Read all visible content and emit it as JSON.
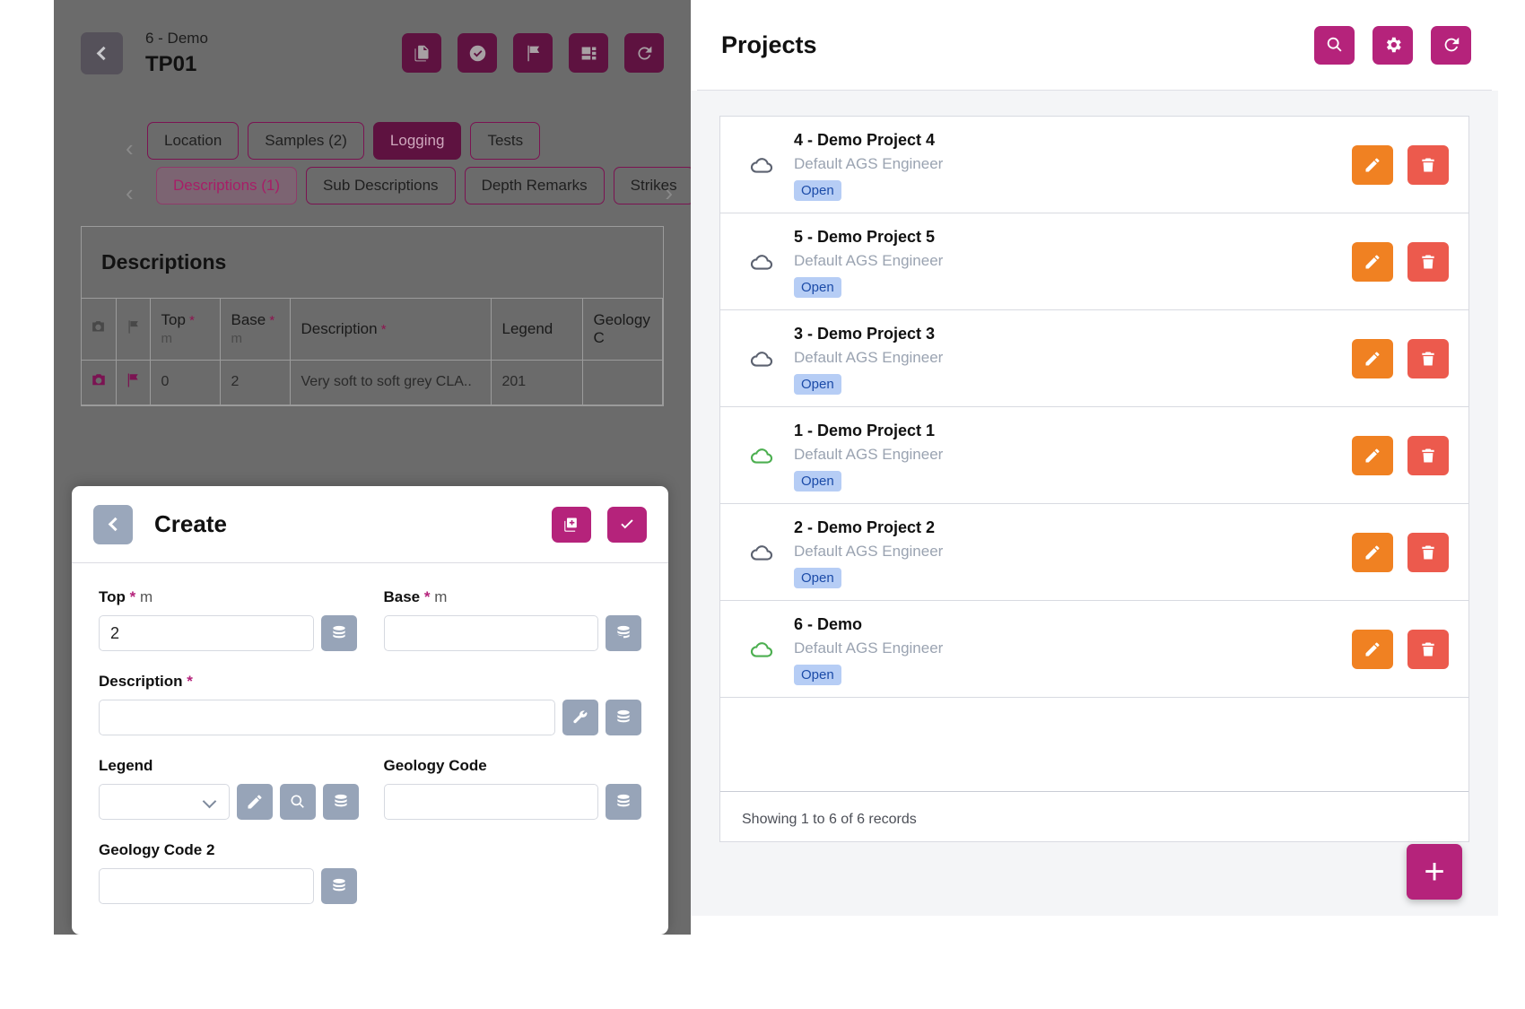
{
  "left": {
    "header": {
      "back_icon": "chevron-left-icon",
      "subtitle": "6 - Demo",
      "title": "TP01",
      "actions": [
        {
          "name": "pdf-export-button",
          "icon": "pdf-file-icon"
        },
        {
          "name": "approve-button",
          "icon": "check-circle-icon"
        },
        {
          "name": "flag-button",
          "icon": "flag-icon"
        },
        {
          "name": "layout-button",
          "icon": "dashboard-icon"
        },
        {
          "name": "refresh-button",
          "icon": "refresh-icon"
        }
      ]
    },
    "tabs_primary": [
      {
        "label": "Location",
        "active": false
      },
      {
        "label": "Samples (2)",
        "active": false
      },
      {
        "label": "Logging",
        "active": true
      },
      {
        "label": "Tests",
        "active": false
      }
    ],
    "tabs_secondary": [
      {
        "label": "Descriptions (1)",
        "active": true
      },
      {
        "label": "Sub Descriptions",
        "active": false
      },
      {
        "label": "Depth Remarks",
        "active": false
      },
      {
        "label": "Strikes",
        "active": false
      }
    ],
    "table": {
      "card_title": "Descriptions",
      "columns": [
        {
          "label": "",
          "icon": "camera-icon"
        },
        {
          "label": "",
          "icon": "flag-icon"
        },
        {
          "label": "Top",
          "required": true,
          "unit": "m"
        },
        {
          "label": "Base",
          "required": true,
          "unit": "m"
        },
        {
          "label": "Description",
          "required": true,
          "unit": ""
        },
        {
          "label": "Legend",
          "required": false,
          "unit": ""
        },
        {
          "label": "Geology C",
          "required": false,
          "unit": ""
        }
      ],
      "rows": [
        {
          "camera_icon": "camera-icon",
          "flag_icon": "flag-icon",
          "top": "0",
          "base": "2",
          "description": "Very soft to soft grey CLA..",
          "legend": "201",
          "geology_code": ""
        }
      ]
    }
  },
  "create_sheet": {
    "back_icon": "chevron-left-icon",
    "title": "Create",
    "actions": [
      {
        "name": "duplicate-button",
        "icon": "copy-add-icon"
      },
      {
        "name": "save-button",
        "icon": "check-icon"
      }
    ],
    "fields": [
      {
        "name": "top",
        "label": "Top",
        "required": true,
        "unit": "m",
        "value": "2",
        "placeholder": "",
        "buttons": [
          {
            "name": "top-library-button",
            "icon": "database-icon"
          }
        ]
      },
      {
        "name": "base",
        "label": "Base",
        "required": true,
        "unit": "m",
        "value": "",
        "placeholder": "",
        "buttons": [
          {
            "name": "base-library-button",
            "icon": "database-icon"
          }
        ]
      },
      {
        "name": "description",
        "label": "Description",
        "required": true,
        "unit": "",
        "value": "",
        "placeholder": "",
        "buttons": [
          {
            "name": "description-builder-button",
            "icon": "wrench-icon"
          },
          {
            "name": "description-library-button",
            "icon": "database-icon"
          }
        ]
      },
      {
        "name": "legend",
        "label": "Legend",
        "required": false,
        "unit": "",
        "value": "",
        "placeholder": "",
        "buttons": [
          {
            "name": "legend-edit-button",
            "icon": "pencil-icon"
          },
          {
            "name": "legend-search-button",
            "icon": "search-icon"
          },
          {
            "name": "legend-library-button",
            "icon": "database-icon"
          }
        ]
      },
      {
        "name": "geology-code",
        "label": "Geology Code",
        "required": false,
        "unit": "",
        "value": "",
        "placeholder": "",
        "buttons": [
          {
            "name": "geology-code-library-button",
            "icon": "database-icon"
          }
        ]
      },
      {
        "name": "geology-code-2",
        "label": "Geology Code 2",
        "required": false,
        "unit": "",
        "value": "",
        "placeholder": "",
        "buttons": [
          {
            "name": "geology-code-2-library-button",
            "icon": "database-icon"
          }
        ]
      }
    ]
  },
  "right": {
    "title": "Projects",
    "actions": [
      {
        "name": "search-button",
        "icon": "search-icon"
      },
      {
        "name": "settings-button",
        "icon": "gear-icon"
      },
      {
        "name": "refresh-button",
        "icon": "refresh-icon"
      }
    ],
    "projects": [
      {
        "name": "4 - Demo Project 4",
        "owner": "Default AGS Engineer",
        "status": "Open",
        "sync": "cloud-grey"
      },
      {
        "name": "5 - Demo Project 5",
        "owner": "Default AGS Engineer",
        "status": "Open",
        "sync": "cloud-grey"
      },
      {
        "name": "3 - Demo Project 3",
        "owner": "Default AGS Engineer",
        "status": "Open",
        "sync": "cloud-grey"
      },
      {
        "name": "1 - Demo Project 1",
        "owner": "Default AGS Engineer",
        "status": "Open",
        "sync": "cloud-green"
      },
      {
        "name": "2 - Demo Project 2",
        "owner": "Default AGS Engineer",
        "status": "Open",
        "sync": "cloud-grey"
      },
      {
        "name": "6 - Demo",
        "owner": "Default AGS Engineer",
        "status": "Open",
        "sync": "cloud-green"
      }
    ],
    "row_actions": {
      "edit": "pencil-icon",
      "delete": "trash-icon"
    },
    "footer": "Showing 1 to 6 of 6 records",
    "fab": {
      "label": "+",
      "name": "add-project-button"
    }
  },
  "colors": {
    "brand_magenta": "#b5237b",
    "brand_dark_plum": "#5e1240",
    "edit_orange": "#f08122",
    "delete_red": "#ec5a4d",
    "badge_blue_bg": "#b6cdf5",
    "badge_blue_text": "#1b4ba8",
    "cloud_green": "#4caf50",
    "overlay_grey": "#6b6b6b"
  }
}
